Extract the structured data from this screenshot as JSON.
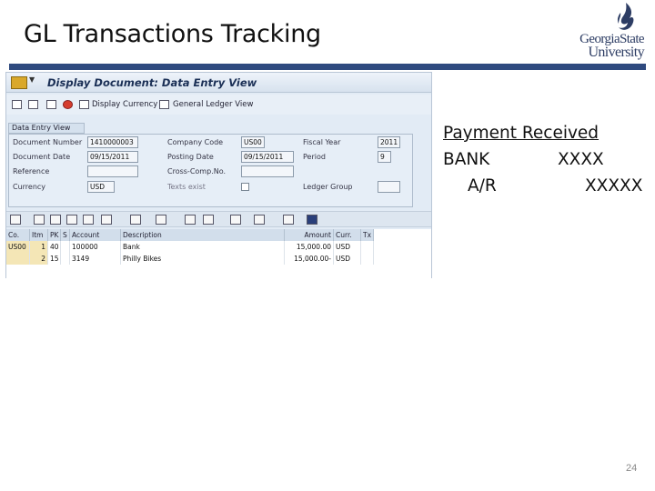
{
  "slide": {
    "title": "GL Transactions Tracking",
    "page_number": "24",
    "logo": {
      "line1": "GeorgiaState",
      "line2": "University",
      "color": "#2d3d64"
    },
    "rule_color": "#2f4a7f"
  },
  "sap": {
    "window_title": "Display Document: Data Entry View",
    "toolbar": {
      "display_currency": "Display Currency",
      "general_ledger_view": "General Ledger View"
    },
    "section_tab": "Data Entry View",
    "header": {
      "document_number": {
        "label": "Document Number",
        "value": "1410000003"
      },
      "company_code": {
        "label": "Company Code",
        "value": "US00"
      },
      "fiscal_year": {
        "label": "Fiscal Year",
        "value": "2011"
      },
      "document_date": {
        "label": "Document Date",
        "value": "09/15/2011"
      },
      "posting_date": {
        "label": "Posting Date",
        "value": "09/15/2011"
      },
      "period": {
        "label": "Period",
        "value": "9"
      },
      "reference": {
        "label": "Reference",
        "value": ""
      },
      "cross_comp_no": {
        "label": "Cross-Comp.No.",
        "value": ""
      },
      "currency": {
        "label": "Currency",
        "value": "USD"
      },
      "texts_exist": {
        "label": "Texts exist",
        "checked": false
      },
      "ledger_group": {
        "label": "Ledger Group",
        "value": ""
      }
    },
    "grid": {
      "columns": [
        "Co.",
        "Itm",
        "PK",
        "S",
        "Account",
        "Description",
        "Amount",
        "Curr.",
        "Tx"
      ],
      "rows": [
        {
          "co": "US00",
          "itm": "1",
          "pk": "40",
          "s": "",
          "account": "100000",
          "description": "Bank",
          "amount": "15,000.00",
          "curr": "USD",
          "tx": ""
        },
        {
          "co": "",
          "itm": "2",
          "pk": "15",
          "s": "",
          "account": "3149",
          "description": "Philly Bikes",
          "amount": "15,000.00-",
          "curr": "USD",
          "tx": ""
        }
      ],
      "key_highlight_color": "#f4e6b6"
    }
  },
  "notes": {
    "heading": "Payment Received",
    "lines": [
      {
        "account": "BANK",
        "amount": "XXXX"
      },
      {
        "account": "A/R",
        "amount": "XXXXX"
      }
    ]
  }
}
